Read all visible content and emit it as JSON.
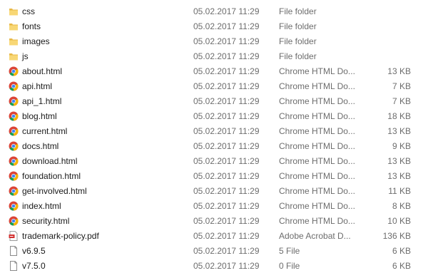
{
  "files": [
    {
      "name": "css",
      "date": "05.02.2017 11:29",
      "type": "File folder",
      "size": "",
      "icon": "folder-icon"
    },
    {
      "name": "fonts",
      "date": "05.02.2017 11:29",
      "type": "File folder",
      "size": "",
      "icon": "folder-icon"
    },
    {
      "name": "images",
      "date": "05.02.2017 11:29",
      "type": "File folder",
      "size": "",
      "icon": "folder-icon"
    },
    {
      "name": "js",
      "date": "05.02.2017 11:29",
      "type": "File folder",
      "size": "",
      "icon": "folder-icon"
    },
    {
      "name": "about.html",
      "date": "05.02.2017 11:29",
      "type": "Chrome HTML Do...",
      "size": "13 KB",
      "icon": "chrome-icon"
    },
    {
      "name": "api.html",
      "date": "05.02.2017 11:29",
      "type": "Chrome HTML Do...",
      "size": "7 KB",
      "icon": "chrome-icon"
    },
    {
      "name": "api_1.html",
      "date": "05.02.2017 11:29",
      "type": "Chrome HTML Do...",
      "size": "7 KB",
      "icon": "chrome-icon"
    },
    {
      "name": "blog.html",
      "date": "05.02.2017 11:29",
      "type": "Chrome HTML Do...",
      "size": "18 KB",
      "icon": "chrome-icon"
    },
    {
      "name": "current.html",
      "date": "05.02.2017 11:29",
      "type": "Chrome HTML Do...",
      "size": "13 KB",
      "icon": "chrome-icon"
    },
    {
      "name": "docs.html",
      "date": "05.02.2017 11:29",
      "type": "Chrome HTML Do...",
      "size": "9 KB",
      "icon": "chrome-icon"
    },
    {
      "name": "download.html",
      "date": "05.02.2017 11:29",
      "type": "Chrome HTML Do...",
      "size": "13 KB",
      "icon": "chrome-icon"
    },
    {
      "name": "foundation.html",
      "date": "05.02.2017 11:29",
      "type": "Chrome HTML Do...",
      "size": "13 KB",
      "icon": "chrome-icon"
    },
    {
      "name": "get-involved.html",
      "date": "05.02.2017 11:29",
      "type": "Chrome HTML Do...",
      "size": "11 KB",
      "icon": "chrome-icon"
    },
    {
      "name": "index.html",
      "date": "05.02.2017 11:29",
      "type": "Chrome HTML Do...",
      "size": "8 KB",
      "icon": "chrome-icon"
    },
    {
      "name": "security.html",
      "date": "05.02.2017 11:29",
      "type": "Chrome HTML Do...",
      "size": "10 KB",
      "icon": "chrome-icon"
    },
    {
      "name": "trademark-policy.pdf",
      "date": "05.02.2017 11:29",
      "type": "Adobe Acrobat D...",
      "size": "136 KB",
      "icon": "pdf-icon"
    },
    {
      "name": "v6.9.5",
      "date": "05.02.2017 11:29",
      "type": "5 File",
      "size": "6 KB",
      "icon": "file-icon"
    },
    {
      "name": "v7.5.0",
      "date": "05.02.2017 11:29",
      "type": "0 File",
      "size": "6 KB",
      "icon": "file-icon"
    }
  ],
  "colors": {
    "folder": "#f8d775",
    "folder_dark": "#e8b846",
    "pdf_red": "#d32f2f"
  }
}
